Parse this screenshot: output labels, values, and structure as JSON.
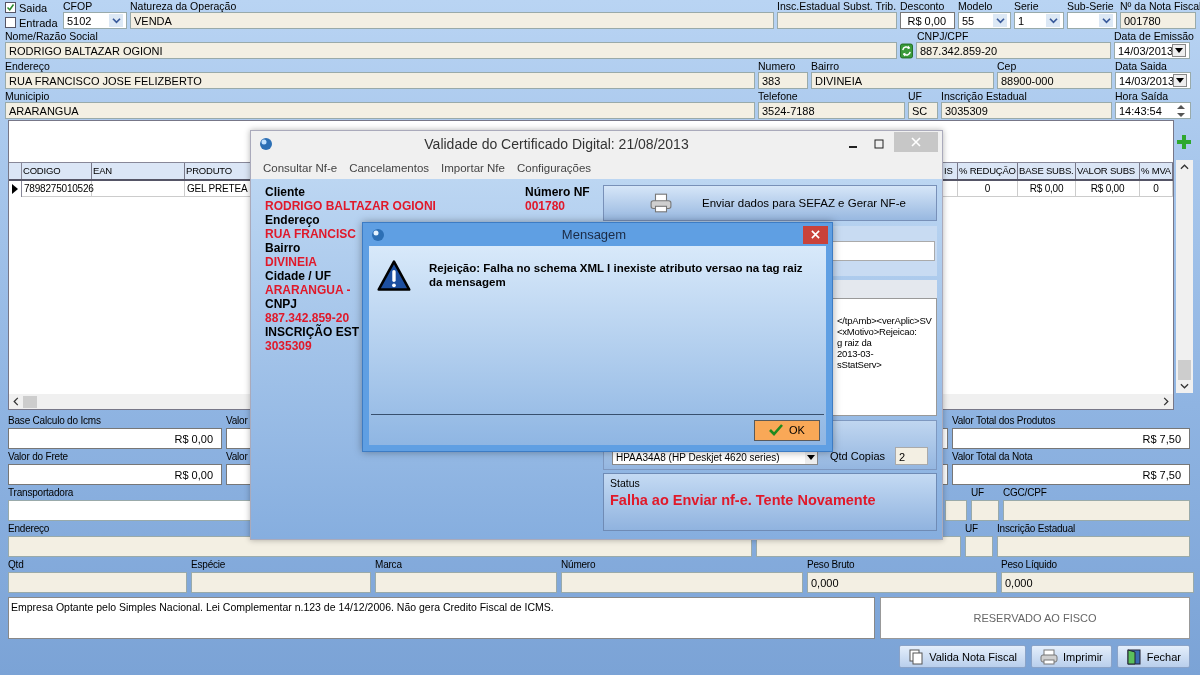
{
  "form": {
    "checks": [
      {
        "label": "Saida",
        "checked": true
      },
      {
        "label": "Entrada",
        "checked": false
      }
    ],
    "sections": [
      {
        "fields": [
          {
            "label": "CFOP",
            "value": "5102",
            "kind": "combo"
          },
          {
            "label": "Natureza da Operação",
            "value": "VENDA",
            "kind": "text"
          },
          {
            "label": "Insc.Estadual Subst. Trib.",
            "kind": "text"
          },
          {
            "label": "Desconto",
            "value": "R$ 0,00",
            "kind": "money"
          },
          {
            "label": "Modelo",
            "value": "55",
            "kind": "combo"
          },
          {
            "label": "Serie",
            "value": "1",
            "kind": "combo"
          },
          {
            "label": "Sub-Serie",
            "kind": "combo"
          },
          {
            "label": "Nº da Nota Fiscal",
            "value": "001780",
            "kind": "text"
          }
        ]
      },
      {
        "fields": [
          {
            "label": "Nome/Razão Social",
            "value": "RODRIGO BALTAZAR OGIONI",
            "kind": "text"
          },
          {
            "label": "CNPJ/CPF",
            "value": "887.342.859-20",
            "kind": "lookup"
          },
          {
            "label": "Data de Emissão",
            "value": "14/03/2013",
            "kind": "date"
          }
        ]
      },
      {
        "fields": [
          {
            "label": "Endereço",
            "value": "RUA FRANCISCO JOSE FELIZBERTO",
            "kind": "text"
          },
          {
            "label": "Numero",
            "value": "383",
            "kind": "text"
          },
          {
            "label": "Bairro",
            "value": "DIVINEIA",
            "kind": "text"
          },
          {
            "label": "Cep",
            "value": "88900-000",
            "kind": "text"
          },
          {
            "label": "Data Saida",
            "value": "14/03/2013",
            "kind": "date"
          }
        ]
      },
      {
        "fields": [
          {
            "label": "Municipio",
            "value": "ARARANGUA",
            "kind": "text"
          },
          {
            "label": "Telefone",
            "value": "3524-7188",
            "kind": "text"
          },
          {
            "label": "UF",
            "value": "SC",
            "kind": "text"
          },
          {
            "label": "Inscrição Estadual",
            "value": "3035309",
            "kind": "text"
          },
          {
            "label": "Hora Saída",
            "value": "14:43:54",
            "kind": "time"
          }
        ]
      }
    ]
  },
  "table": {
    "columns": [
      "CODIGO",
      "EAN",
      "PRODUTO",
      "IS",
      "% REDUÇÃO",
      "BASE SUBS.",
      "VALOR SUBS",
      "% MVA"
    ],
    "rows": [
      {
        "selected": true,
        "cells": [
          "7898275010526",
          "",
          "GEL PRETEA",
          "",
          "0",
          "R$ 0,00",
          "R$ 0,00",
          "0"
        ]
      }
    ]
  },
  "totals": [
    {
      "fields": [
        {
          "label": "Base Calculo do Icms",
          "value": "R$ 0,00",
          "kind": "money"
        },
        {
          "label": "Valor",
          "kind": "money"
        },
        {
          "label": "Valor Total dos Produtos",
          "value": "R$ 7,50",
          "kind": "money"
        }
      ]
    },
    {
      "fields": [
        {
          "label": "Valor do Frete",
          "value": "R$ 0,00",
          "kind": "money"
        },
        {
          "label": "Valor",
          "kind": "money"
        },
        {
          "label": "Valor Total da Nota",
          "value": "R$ 7,50",
          "kind": "money"
        }
      ]
    },
    {
      "fields": [
        {
          "label": "Transportadora",
          "kind": "blank"
        },
        {
          "kind": "text"
        },
        {
          "label": "UF",
          "kind": "text"
        },
        {
          "label": "CGC/CPF",
          "kind": "text"
        }
      ]
    },
    {
      "fields": [
        {
          "label": "Endereço",
          "kind": "text"
        },
        {
          "kind": "text"
        },
        {
          "label": "UF",
          "kind": "text"
        },
        {
          "label": "Inscrição Estadual",
          "kind": "text"
        }
      ]
    },
    {
      "fields": [
        {
          "label": "Qtd",
          "kind": "text"
        },
        {
          "label": "Espécie",
          "kind": "text"
        },
        {
          "label": "Marca",
          "kind": "text"
        },
        {
          "label": "Número",
          "kind": "text"
        },
        {
          "label": "Peso Bruto",
          "value": "0,000",
          "kind": "text"
        },
        {
          "label": "Peso Líquido",
          "value": "0,000",
          "kind": "text"
        }
      ]
    }
  ],
  "notes": "Empresa Optante pelo Simples Nacional. Lei Complementar n.123 de 14/12/2006. Não gera Credito Fiscal de ICMS.",
  "reserved": "RESERVADO AO FISCO",
  "buttons": [
    "Valida Nota Fiscal",
    "Imprimir",
    "Fechar"
  ],
  "cert_window": {
    "title": "Validade do Certificado Digital: 21/08/2013",
    "menu": [
      "Consultar Nf-e",
      "Cancelamentos",
      "Importar Nfe",
      "Configurações"
    ],
    "info": [
      {
        "label": "Cliente",
        "value": "RODRIGO BALTAZAR OGIONI"
      },
      {
        "label": "Endereço",
        "value": "RUA FRANCISC"
      },
      {
        "label": "Bairro",
        "value": "DIVINEIA"
      },
      {
        "label": "Cidade / UF",
        "value": "ARARANGUA -"
      },
      {
        "label": "CNPJ",
        "value": "887.342.859-20"
      },
      {
        "label": "INSCRIÇÃO EST",
        "value": "3035309"
      }
    ],
    "number": {
      "label": "Número NF",
      "value": "001780"
    },
    "send_button": "Enviar dados para SEFAZ e Gerar NF-e",
    "log": [
      "</tpAmb><verAplic>SV",
      "<xMotivo>Rejeicao:",
      "g raiz da",
      "2013-03-",
      "sStatServ>"
    ],
    "printer": "HPAA34A8 (HP Deskjet 4620 series)",
    "copies": {
      "label": "Qtd Copias",
      "value": "2"
    },
    "status": {
      "label": "Status",
      "value": "Falha ao Enviar nf-e. Tente Novamente"
    }
  },
  "message": {
    "title": "Mensagem",
    "text": "Rejeição: Falha no schema XML I inexiste atributo versao na tag raiz da mensagem",
    "button": "OK"
  }
}
